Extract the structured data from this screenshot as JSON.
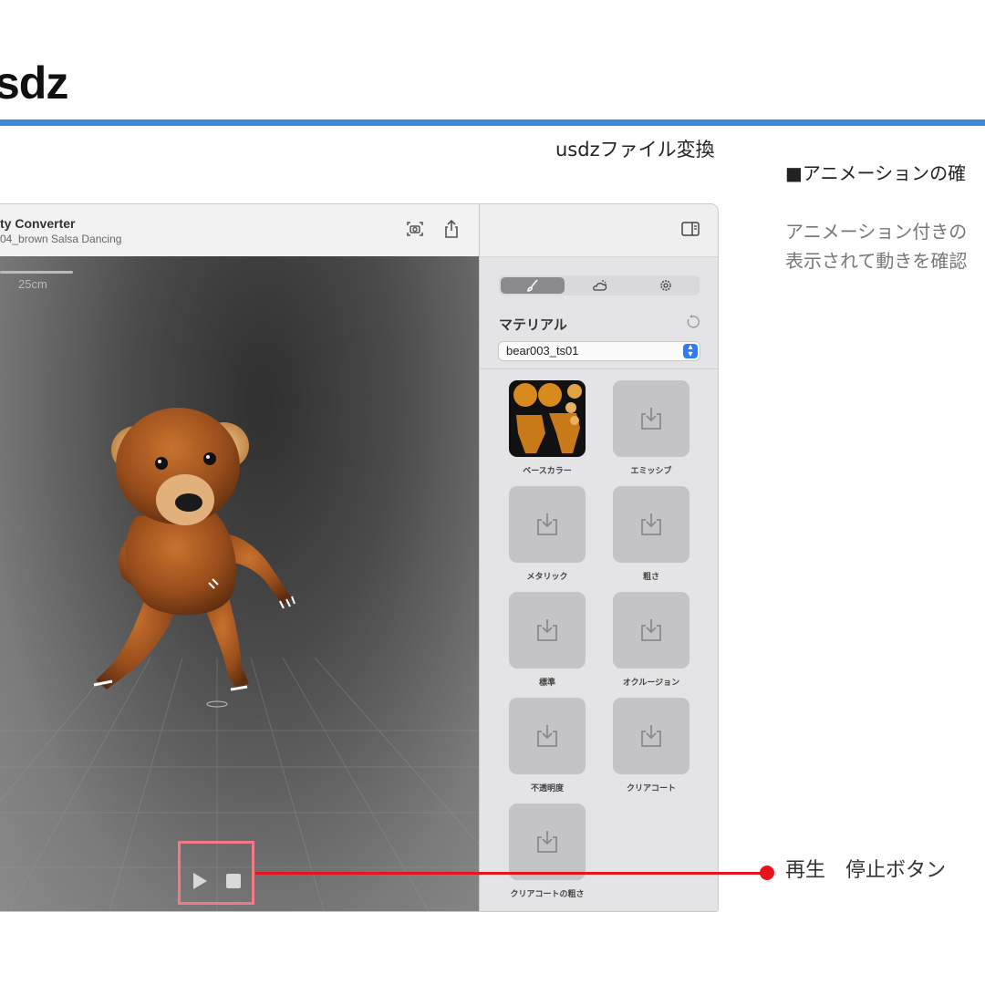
{
  "slide": {
    "title": "sdz",
    "caption": "usdzファイル変換",
    "notes_heading": "■アニメーションの確",
    "notes_lines": [
      "アニメーション付きの",
      "表示されて動きを確認"
    ],
    "annotation_label": "再生　停止ボタン",
    "accent_color": "#3d8ae0",
    "annotation_color": "#e8141c"
  },
  "app": {
    "title": "ty Converter",
    "subtitle": "04_brown Salsa Dancing",
    "toolbar_icons": [
      "snapshot-icon",
      "share-icon"
    ],
    "viewport": {
      "scale_label": "25cm",
      "controls": [
        "play-icon",
        "stop-icon"
      ]
    },
    "inspector": {
      "tabs": [
        "paintbrush-icon",
        "weather-icon",
        "gear-icon"
      ],
      "selected_tab": 0,
      "material_label": "マテリアル",
      "material_value": "bear003_ts01",
      "slots": [
        {
          "label": "ベースカラー",
          "filled": true
        },
        {
          "label": "エミッシブ",
          "filled": false
        },
        {
          "label": "メタリック",
          "filled": false
        },
        {
          "label": "粗さ",
          "filled": false
        },
        {
          "label": "標準",
          "filled": false
        },
        {
          "label": "オクルージョン",
          "filled": false
        },
        {
          "label": "不透明度",
          "filled": false
        },
        {
          "label": "クリアコート",
          "filled": false
        },
        {
          "label": "クリアコートの粗さ",
          "filled": false
        }
      ]
    }
  }
}
